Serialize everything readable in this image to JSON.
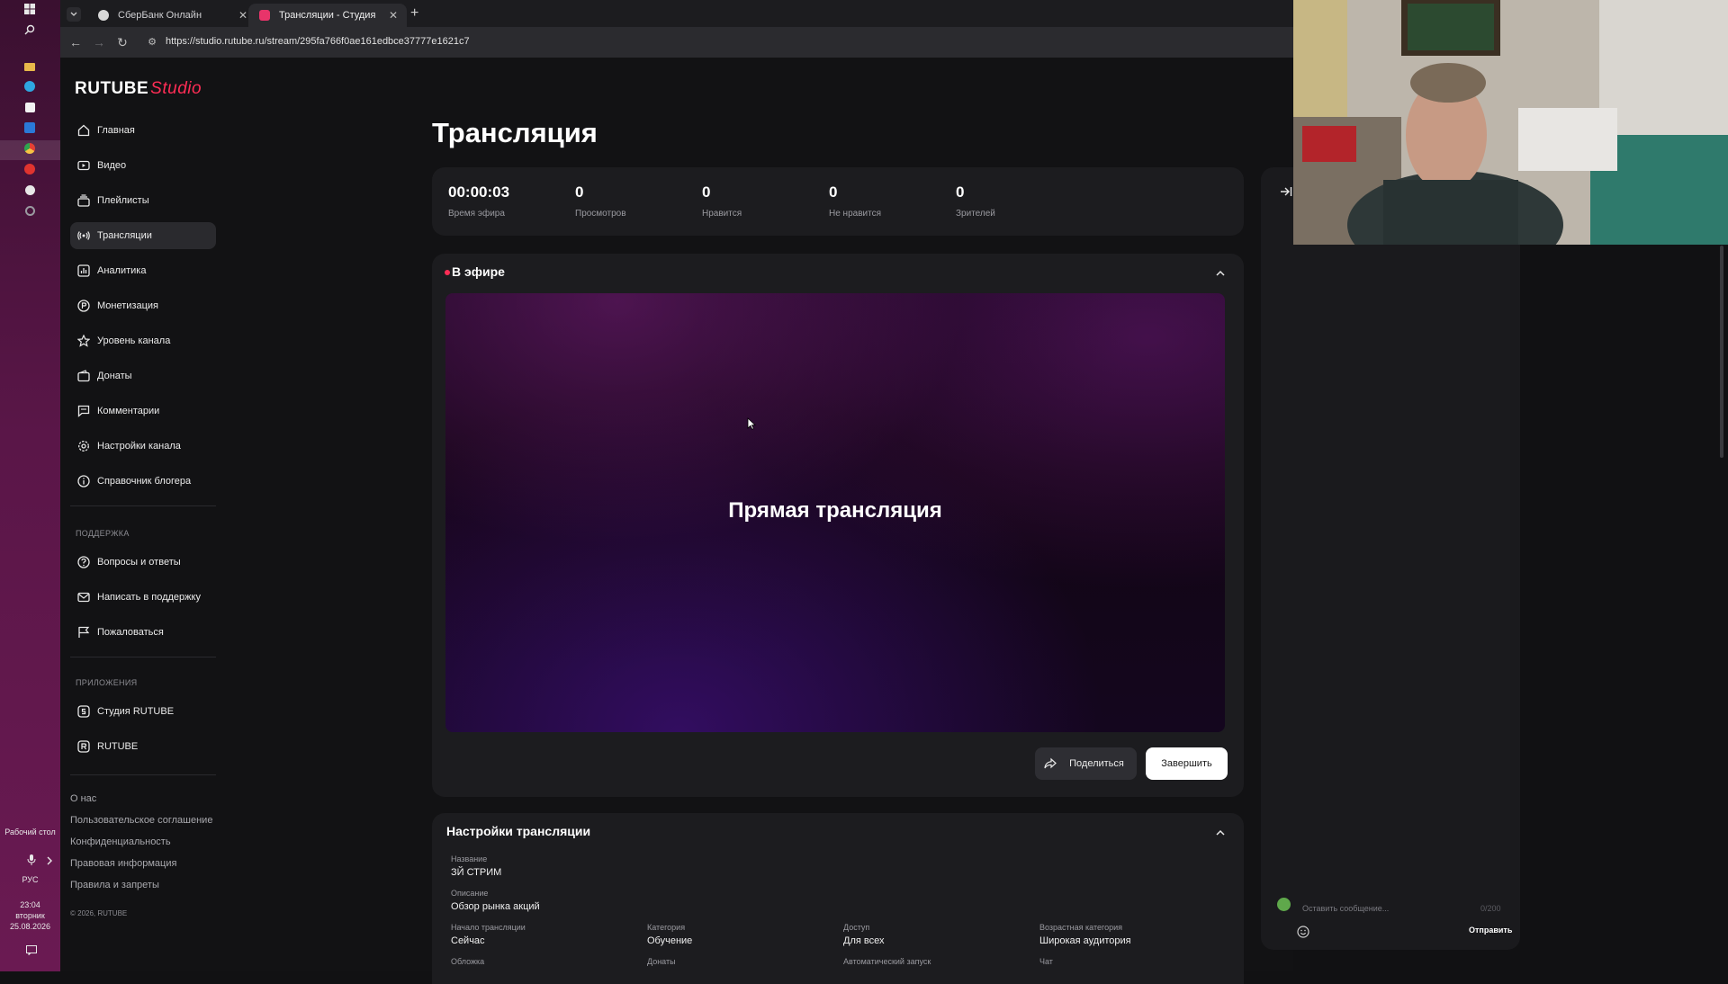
{
  "taskbar": {
    "desktop_label": "Рабочий стол",
    "lang": "РУС",
    "time": "23:04",
    "weekday": "вторник",
    "date": "25.08.2026"
  },
  "browser": {
    "tabs": [
      {
        "label": "СберБанк Онлайн",
        "active": false
      },
      {
        "label": "Трансляции - Студия RUTUBE",
        "active": true
      }
    ],
    "url": "https://studio.rutube.ru/stream/295fa766f0ae161edbce37777e1621c7"
  },
  "logo": {
    "main": "RUTUBE",
    "studio": "Studio"
  },
  "nav": [
    {
      "label": "Главная",
      "icon": "home-icon"
    },
    {
      "label": "Видео",
      "icon": "video-icon"
    },
    {
      "label": "Плейлисты",
      "icon": "playlist-icon"
    },
    {
      "label": "Трансляции",
      "icon": "broadcast-icon",
      "active": true
    },
    {
      "label": "Аналитика",
      "icon": "analytics-icon"
    },
    {
      "label": "Монетизация",
      "icon": "coin-icon"
    },
    {
      "label": "Уровень канала",
      "icon": "star-icon"
    },
    {
      "label": "Донаты",
      "icon": "wallet-icon"
    },
    {
      "label": "Комментарии",
      "icon": "comment-icon"
    },
    {
      "label": "Настройки канала",
      "icon": "gear-icon"
    },
    {
      "label": "Справочник блогера",
      "icon": "info-icon"
    }
  ],
  "support": {
    "title": "ПОДДЕРЖКА",
    "items": [
      {
        "label": "Вопросы и ответы",
        "icon": "question-icon"
      },
      {
        "label": "Написать в поддержку",
        "icon": "mail-icon"
      },
      {
        "label": "Пожаловаться",
        "icon": "flag-icon"
      }
    ]
  },
  "apps": {
    "title": "ПРИЛОЖЕНИЯ",
    "items": [
      {
        "label": "Студия RUTUBE",
        "icon": "studio-app-icon"
      },
      {
        "label": "RUTUBE",
        "icon": "rutube-app-icon"
      }
    ]
  },
  "footer": {
    "links": [
      "О нас",
      "Пользовательское соглашение",
      "Конфиденциальность",
      "Правовая информация",
      "Правила и запреты"
    ],
    "copyright": "© 2026, RUTUBE"
  },
  "page": {
    "title": "Трансляция"
  },
  "stats": [
    {
      "value": "00:00:03",
      "label": "Время эфира"
    },
    {
      "value": "0",
      "label": "Просмотров"
    },
    {
      "value": "0",
      "label": "Нравится"
    },
    {
      "value": "0",
      "label": "Не нравится"
    },
    {
      "value": "0",
      "label": "Зрителей"
    }
  ],
  "live": {
    "title": "В эфире",
    "player_text": "Прямая трансляция",
    "share_label": "Поделиться",
    "end_label": "Завершить"
  },
  "settings": {
    "title": "Настройки трансляции",
    "name_label": "Название",
    "name_value": "ЗЙ СТРИМ",
    "desc_label": "Описание",
    "desc_value": "Обзор рынка акций",
    "fields": [
      {
        "label": "Начало трансляции",
        "value": "Сейчас"
      },
      {
        "label": "Категория",
        "value": "Обучение"
      },
      {
        "label": "Доступ",
        "value": "Для всех"
      },
      {
        "label": "Возрастная категория",
        "value": "Широкая аудитория"
      }
    ],
    "fields_row2": [
      "Обложка",
      "Донаты",
      "Автоматический запуск",
      "Чат"
    ]
  },
  "chat": {
    "placeholder": "Оставить сообщение...",
    "counter": "0/200",
    "send_label": "Отправить"
  }
}
